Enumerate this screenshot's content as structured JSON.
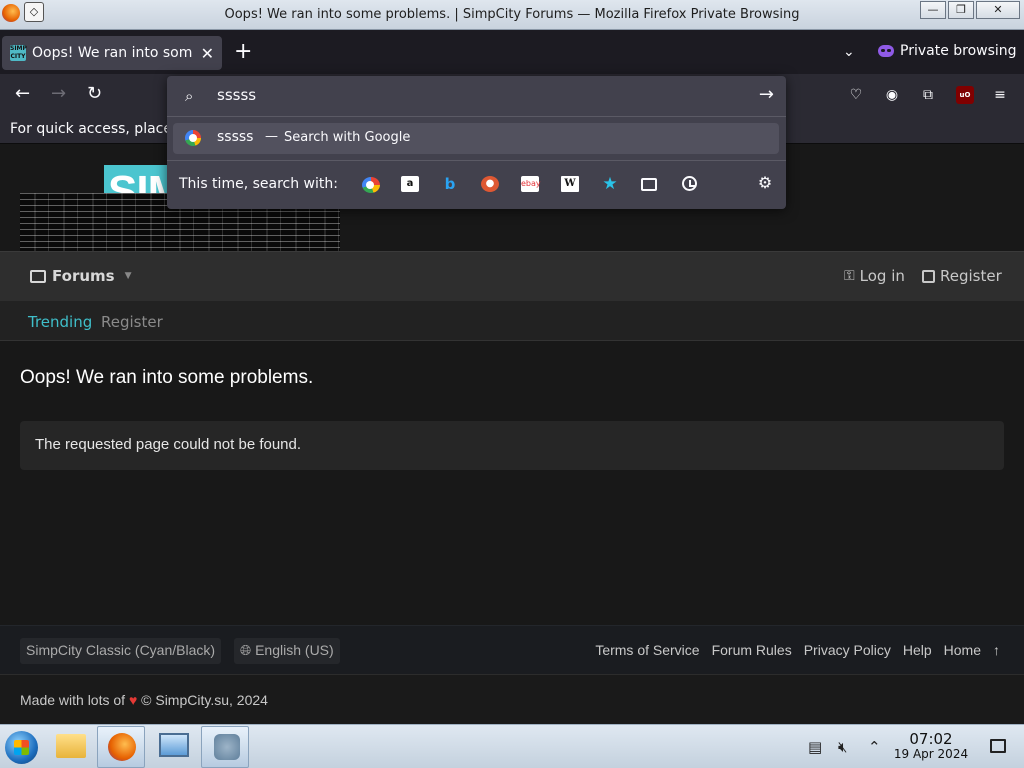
{
  "window": {
    "title": "Oops! We ran into some problems. | SimpCity Forums — Mozilla Firefox Private Browsing",
    "minimize": "—",
    "maximize": "❐",
    "close": "✕"
  },
  "browser": {
    "tab": {
      "favicon_text": "SIMP CITY",
      "title": "Oops! We ran into some problems. | SimpCity Forums",
      "close": "✕"
    },
    "new_tab": "+",
    "tab_list": "⌄",
    "private_label": "Private browsing",
    "bookmarks_hint": "For quick access, place"
  },
  "urlbar": {
    "query": "sssss",
    "suggestion": {
      "query": "sssss",
      "separator": "—",
      "action": "Search with Google"
    },
    "one_off_label": "This time, search with:",
    "engines": [
      "google-icon",
      "amazon-icon",
      "bing-icon",
      "duckduckgo-icon",
      "ebay-icon",
      "wikipedia-icon",
      "bookmarks-icon",
      "tabs-icon",
      "history-icon"
    ],
    "engine_glyphs": {
      "amazon": "a",
      "bing": "b",
      "ebay": "ebay",
      "wiki": "W",
      "star": "★",
      "gear": "⚙"
    }
  },
  "site": {
    "logo_text": "SIMP",
    "nav": {
      "forums": "Forums",
      "login": "Log in",
      "register": "Register"
    },
    "subnav": {
      "trending": "Trending",
      "register": "Register"
    },
    "error_title": "Oops! We ran into some problems.",
    "error_message": "The requested page could not be found.",
    "footer": {
      "style_chooser": "SimpCity Classic (Cyan/Black)",
      "language": "English (US)",
      "links": [
        "Terms of Service",
        "Forum Rules",
        "Privacy Policy",
        "Help",
        "Home"
      ],
      "made_with": "Made with lots of",
      "copyright": "© SimpCity.su, 2024"
    },
    "accent_color": "#3fbfca"
  },
  "taskbar": {
    "time": "07:02",
    "date": "19 Apr 2024"
  }
}
